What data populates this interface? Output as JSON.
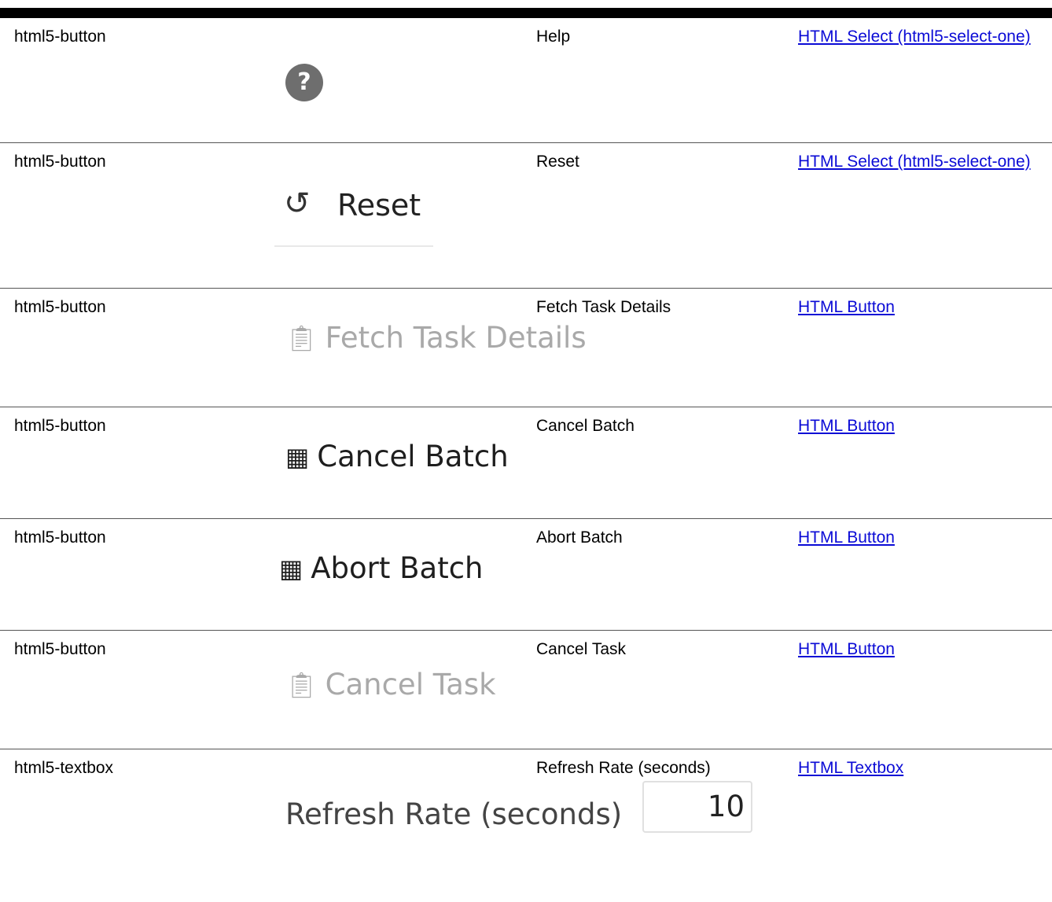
{
  "rows": [
    {
      "type": "html5-button",
      "label": "Help",
      "link": "HTML Select (html5-select-one)",
      "shot_text": "?"
    },
    {
      "type": "html5-button",
      "label": "Reset",
      "link": "HTML Select (html5-select-one)",
      "shot_text": "Reset"
    },
    {
      "type": "html5-button",
      "label": "Fetch Task Details",
      "link": "HTML Button",
      "shot_text": "Fetch Task Details"
    },
    {
      "type": "html5-button",
      "label": "Cancel Batch",
      "link": "HTML Button",
      "shot_text": "Cancel Batch"
    },
    {
      "type": "html5-button",
      "label": "Abort Batch",
      "link": "HTML Button",
      "shot_text": "Abort Batch"
    },
    {
      "type": "html5-button",
      "label": "Cancel Task",
      "link": "HTML Button",
      "shot_text": "Cancel Task"
    },
    {
      "type": "html5-textbox",
      "label": "Refresh Rate (seconds)",
      "link": "HTML Textbox",
      "shot_text": "Refresh Rate (seconds)",
      "shot_value": "10"
    }
  ],
  "icons": {
    "help": "help-icon",
    "reset": "reset-icon",
    "fetch": "clipboard-icon",
    "batch": "grid-cancel-icon",
    "task": "clipboard-cancel-icon"
  }
}
